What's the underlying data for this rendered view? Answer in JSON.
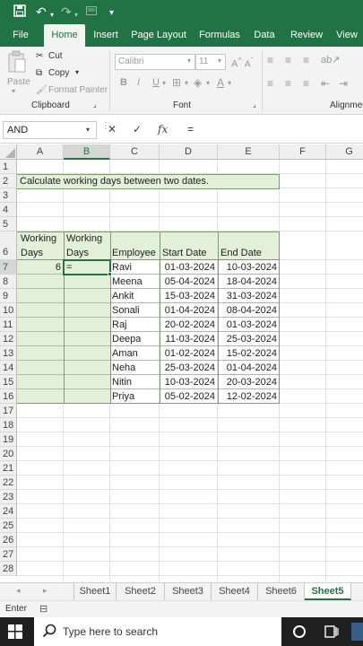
{
  "ribbon_tabs": [
    "File",
    "Home",
    "Insert",
    "Page Layout",
    "Formulas",
    "Data",
    "Review",
    "View"
  ],
  "active_tab": "Home",
  "clipboard": {
    "paste": "Paste",
    "cut": "Cut",
    "copy": "Copy",
    "format_painter": "Format Painter",
    "group_label": "Clipboard"
  },
  "font": {
    "name": "Calibri",
    "size": "11",
    "group_label": "Font",
    "bold": "B",
    "italic": "I",
    "underline": "U"
  },
  "alignment": {
    "group_label": "Alignmen"
  },
  "formula_bar": {
    "name_box": "AND",
    "cancel": "✕",
    "enter": "✓",
    "fx": "fx",
    "value": "="
  },
  "columns": [
    "A",
    "B",
    "C",
    "D",
    "E",
    "F",
    "G"
  ],
  "rows": [
    "1",
    "2",
    "3",
    "4",
    "5",
    "6",
    "7",
    "8",
    "9",
    "10",
    "11",
    "12",
    "13",
    "14",
    "15",
    "16",
    "17",
    "18",
    "19",
    "20",
    "21",
    "22",
    "23",
    "24",
    "25",
    "26",
    "27",
    "28"
  ],
  "sheet": {
    "title": "Calculate working days between two dates.",
    "headers": {
      "a1": "Working",
      "a2": "Days",
      "b1": "Working",
      "b2": "Days",
      "c": "Employee",
      "d": "Start Date",
      "e": "End Date"
    },
    "a7": "6",
    "b7": "=",
    "data": [
      {
        "employee": "Ravi",
        "start": "01-03-2024",
        "end": "10-03-2024"
      },
      {
        "employee": "Meena",
        "start": "05-04-2024",
        "end": "18-04-2024"
      },
      {
        "employee": "Ankit",
        "start": "15-03-2024",
        "end": "31-03-2024"
      },
      {
        "employee": "Sonali",
        "start": "01-04-2024",
        "end": "08-04-2024"
      },
      {
        "employee": "Raj",
        "start": "20-02-2024",
        "end": "01-03-2024"
      },
      {
        "employee": "Deepa",
        "start": "11-03-2024",
        "end": "25-03-2024"
      },
      {
        "employee": "Aman",
        "start": "01-02-2024",
        "end": "15-02-2024"
      },
      {
        "employee": "Neha",
        "start": "25-03-2024",
        "end": "01-04-2024"
      },
      {
        "employee": "Nitin",
        "start": "10-03-2024",
        "end": "20-03-2024"
      },
      {
        "employee": "Priya",
        "start": "05-02-2024",
        "end": "12-02-2024"
      }
    ]
  },
  "sheet_tabs": [
    "Sheet1",
    "Sheet2",
    "Sheet3",
    "Sheet4",
    "Sheet6",
    "Sheet5"
  ],
  "active_sheet": "Sheet5",
  "status": {
    "mode": "Enter"
  },
  "taskbar": {
    "search_placeholder": "Type here to search"
  },
  "colors": {
    "excel_green": "#217346",
    "cell_fill": "#e2efd9",
    "taskbar": "#202020"
  }
}
